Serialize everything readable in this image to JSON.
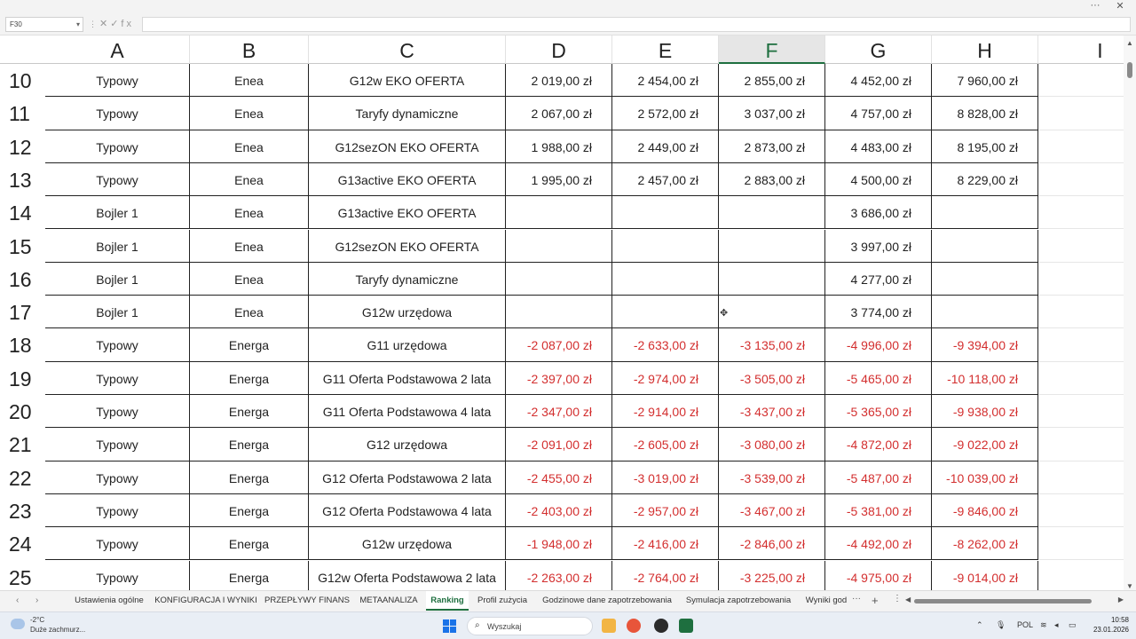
{
  "window": {
    "more_glyph": "···",
    "close_glyph": "✕"
  },
  "formula_bar": {
    "cell_ref": "F30",
    "caret": "▾",
    "separator": "⋮",
    "icons": "✕✓fx",
    "value": ""
  },
  "columns": [
    "A",
    "B",
    "C",
    "D",
    "E",
    "F",
    "G",
    "H",
    "I"
  ],
  "active_column": "F",
  "rows": [
    {
      "num": "10",
      "a": "Typowy",
      "b": "Enea",
      "c": "G12w EKO OFERTA",
      "d": "2 019,00 zł",
      "e": "2 454,00 zł",
      "f": "2 855,00 zł",
      "g": "4 452,00 zł",
      "h": "7 960,00 zł",
      "negative": false
    },
    {
      "num": "11",
      "a": "Typowy",
      "b": "Enea",
      "c": "Taryfy dynamiczne",
      "d": "2 067,00 zł",
      "e": "2 572,00 zł",
      "f": "3 037,00 zł",
      "g": "4 757,00 zł",
      "h": "8 828,00 zł",
      "negative": false
    },
    {
      "num": "12",
      "a": "Typowy",
      "b": "Enea",
      "c": "G12sezON EKO OFERTA",
      "d": "1 988,00 zł",
      "e": "2 449,00 zł",
      "f": "2 873,00 zł",
      "g": "4 483,00 zł",
      "h": "8 195,00 zł",
      "negative": false
    },
    {
      "num": "13",
      "a": "Typowy",
      "b": "Enea",
      "c": "G13active EKO OFERTA",
      "d": "1 995,00 zł",
      "e": "2 457,00 zł",
      "f": "2 883,00 zł",
      "g": "4 500,00 zł",
      "h": "8 229,00 zł",
      "negative": false
    },
    {
      "num": "14",
      "a": "Bojler 1",
      "b": "Enea",
      "c": "G13active EKO OFERTA",
      "d": "",
      "e": "",
      "f": "",
      "g": "3 686,00 zł",
      "h": "",
      "negative": false
    },
    {
      "num": "15",
      "a": "Bojler 1",
      "b": "Enea",
      "c": "G12sezON EKO OFERTA",
      "d": "",
      "e": "",
      "f": "",
      "g": "3 997,00 zł",
      "h": "",
      "negative": false
    },
    {
      "num": "16",
      "a": "Bojler 1",
      "b": "Enea",
      "c": "Taryfy dynamiczne",
      "d": "",
      "e": "",
      "f": "",
      "g": "4 277,00 zł",
      "h": "",
      "negative": false
    },
    {
      "num": "17",
      "a": "Bojler 1",
      "b": "Enea",
      "c": "G12w urzędowa",
      "d": "",
      "e": "",
      "f": "",
      "g": "3 774,00 zł",
      "h": "",
      "negative": false
    },
    {
      "num": "18",
      "a": "Typowy",
      "b": "Energa",
      "c": "G11 urzędowa",
      "d": "-2 087,00 zł",
      "e": "-2 633,00 zł",
      "f": "-3 135,00 zł",
      "g": "-4 996,00 zł",
      "h": "-9 394,00 zł",
      "negative": true
    },
    {
      "num": "19",
      "a": "Typowy",
      "b": "Energa",
      "c": "G11 Oferta Podstawowa 2 lata",
      "d": "-2 397,00 zł",
      "e": "-2 974,00 zł",
      "f": "-3 505,00 zł",
      "g": "-5 465,00 zł",
      "h": "-10 118,00 zł",
      "negative": true
    },
    {
      "num": "20",
      "a": "Typowy",
      "b": "Energa",
      "c": "G11 Oferta Podstawowa 4 lata",
      "d": "-2 347,00 zł",
      "e": "-2 914,00 zł",
      "f": "-3 437,00 zł",
      "g": "-5 365,00 zł",
      "h": "-9 938,00 zł",
      "negative": true
    },
    {
      "num": "21",
      "a": "Typowy",
      "b": "Energa",
      "c": "G12 urzędowa",
      "d": "-2 091,00 zł",
      "e": "-2 605,00 zł",
      "f": "-3 080,00 zł",
      "g": "-4 872,00 zł",
      "h": "-9 022,00 zł",
      "negative": true
    },
    {
      "num": "22",
      "a": "Typowy",
      "b": "Energa",
      "c": "G12 Oferta Podstawowa 2 lata",
      "d": "-2 455,00 zł",
      "e": "-3 019,00 zł",
      "f": "-3 539,00 zł",
      "g": "-5 487,00 zł",
      "h": "-10 039,00 zł",
      "negative": true
    },
    {
      "num": "23",
      "a": "Typowy",
      "b": "Energa",
      "c": "G12 Oferta Podstawowa 4 lata",
      "d": "-2 403,00 zł",
      "e": "-2 957,00 zł",
      "f": "-3 467,00 zł",
      "g": "-5 381,00 zł",
      "h": "-9 846,00 zł",
      "negative": true
    },
    {
      "num": "24",
      "a": "Typowy",
      "b": "Energa",
      "c": "G12w urzędowa",
      "d": "-1 948,00 zł",
      "e": "-2 416,00 zł",
      "f": "-2 846,00 zł",
      "g": "-4 492,00 zł",
      "h": "-8 262,00 zł",
      "negative": true
    },
    {
      "num": "25",
      "a": "Typowy",
      "b": "Energa",
      "c": "G12w Oferta Podstawowa 2 lata",
      "d": "-2 263,00 zł",
      "e": "-2 764,00 zł",
      "f": "-3 225,00 zł",
      "g": "-4 975,00 zł",
      "h": "-9 014,00 zł",
      "negative": true
    }
  ],
  "sheet_tabs": [
    {
      "label": "Ustawienia ogólne",
      "active": false
    },
    {
      "label": "KONFIGURACJA I WYNIKI",
      "active": false
    },
    {
      "label": "PRZEPŁYWY FINANS",
      "active": false
    },
    {
      "label": "METAANALIZA",
      "active": false
    },
    {
      "label": "Ranking",
      "active": true
    },
    {
      "label": "Profil zużycia",
      "active": false
    },
    {
      "label": "Godzinowe dane zapotrzebowania",
      "active": false
    },
    {
      "label": "Symulacja zapotrzebowania",
      "active": false
    },
    {
      "label": "Wyniki god",
      "active": false
    }
  ],
  "tabs_nav": {
    "prev": "‹",
    "next": "›",
    "more": "···",
    "add": "+",
    "options": "⋮"
  },
  "taskbar": {
    "weather_temp": "-2°C",
    "weather_desc": "Duże zachmurz...",
    "search_placeholder": "Wyszukaj",
    "language": "POL",
    "time": "10:58",
    "date": "23.01.2026"
  },
  "colors": {
    "excel_green": "#1e6f3f",
    "negative_red": "#d32f2f",
    "windows_blue": "#1a73e8"
  }
}
